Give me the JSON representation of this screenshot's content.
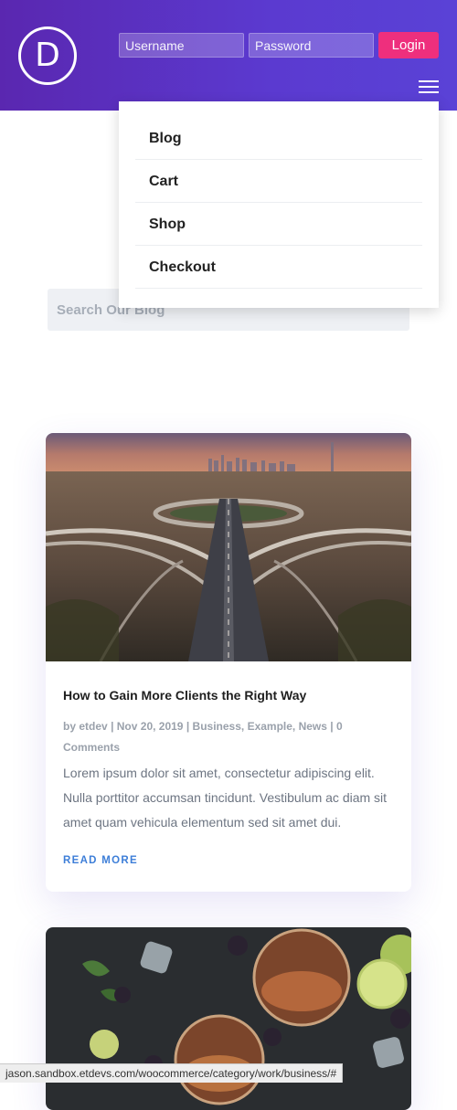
{
  "header": {
    "logo_letter": "D",
    "login": {
      "username_placeholder": "Username",
      "password_placeholder": "Password",
      "button_label": "Login"
    }
  },
  "menu": {
    "items": [
      "Blog",
      "Cart",
      "Shop",
      "Checkout"
    ]
  },
  "search": {
    "placeholder": "Search Our Blog"
  },
  "posts": [
    {
      "title": "How to Gain More Clients the Right Way",
      "author_prefix": "by",
      "author": "etdev",
      "date": "Nov 20, 2019",
      "categories": [
        "Business",
        "Example",
        "News"
      ],
      "comments": "0 Comments",
      "excerpt": "Lorem ipsum dolor sit amet, consectetur adipiscing elit. Nulla porttitor accumsan tincidunt. Vestibulum ac diam sit amet quam vehicula elementum sed sit amet dui.",
      "read_more": "READ MORE"
    }
  ],
  "status_bar": {
    "url": "jason.sandbox.etdevs.com/woocommerce/category/work/business/#"
  },
  "colors": {
    "header_gradient_start": "#5a27b0",
    "header_gradient_end": "#5a42d6",
    "login_button": "#ee2f7d",
    "read_more": "#3d7ed8"
  }
}
